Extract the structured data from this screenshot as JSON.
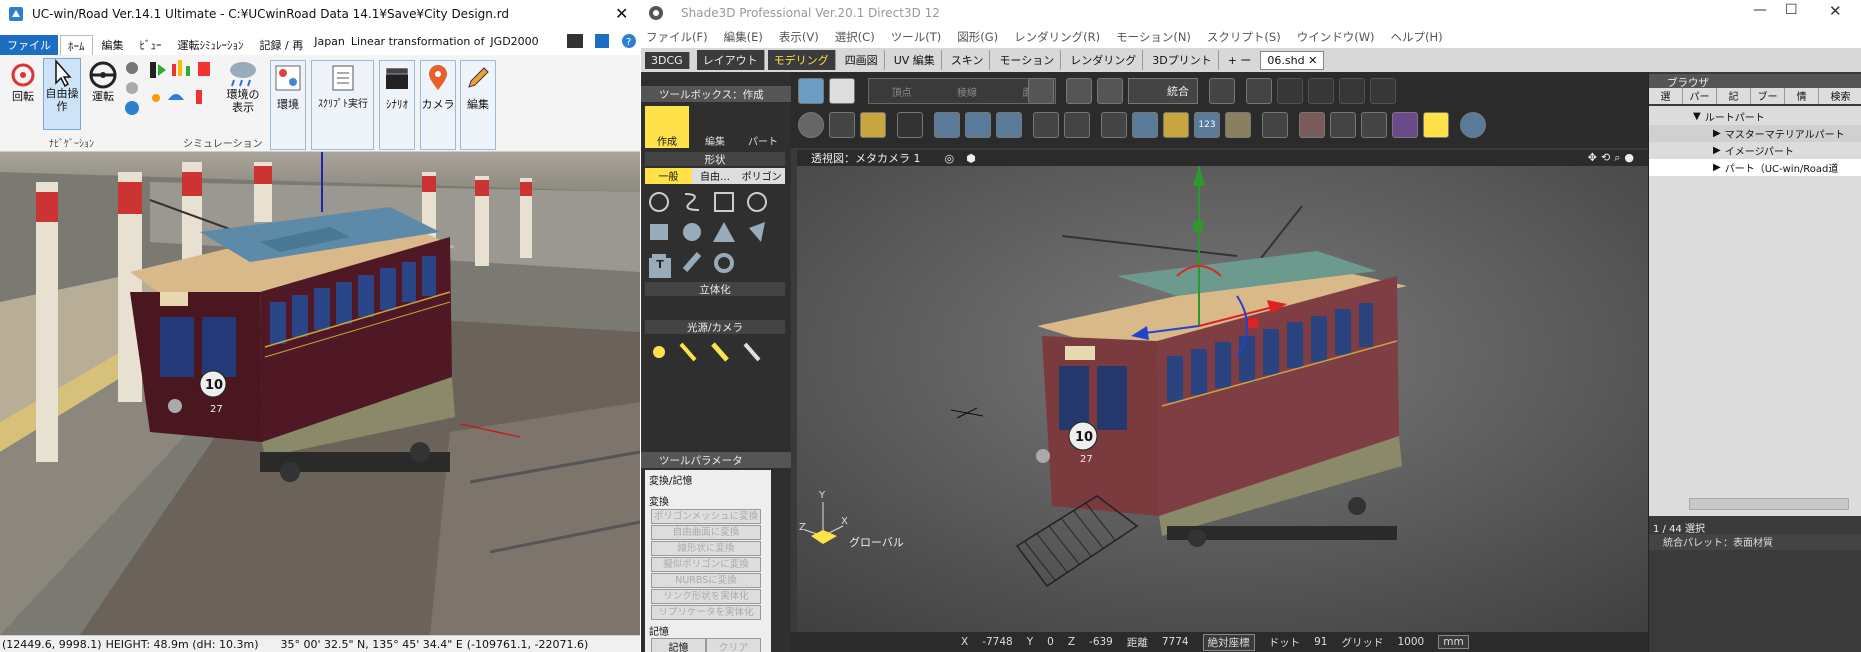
{
  "left": {
    "title": "UC-win/Road Ver.14.1 Ultimate - C:¥UCwinRoad Data 14.1¥Save¥City Design.rd",
    "tabs": [
      "ファイル",
      "ﾎｰﾑ",
      "編集",
      "ﾋﾞｭｰ",
      "運転ｼﾐｭﾚｰｼｮﾝ",
      "記録 / 再",
      "Japan",
      "Linear transformation of",
      "JGD2000"
    ],
    "ribbon": {
      "rotate": "回転",
      "free_nav": "自由操\n作",
      "drive": "運転",
      "nav_group": "ﾅﾋﾞｹﾞｰｼｮﾝ",
      "sim_group": "シミュレーション",
      "env_display": "環境の\n表示",
      "environment": "環境",
      "script_run": "ｽｸﾘﾌﾟﾄ実行",
      "scenario": "ｼﾅﾘｵ",
      "camera": "カメラ",
      "edit": "編集"
    },
    "tram_number": "10",
    "tram_id": "27",
    "status": {
      "coords": "(12449.6, 9998.1)",
      "height": "HEIGHT: 48.9m (dH: 10.3m)",
      "latlon": "35° 00' 32.5\" N, 135° 45' 34.4\" E",
      "proj": "(-109761.1, -22071.6)"
    }
  },
  "right": {
    "title": "Shade3D Professional Ver.20.1 Direct3D 12",
    "menu": [
      "ファイル(F)",
      "編集(E)",
      "表示(V)",
      "選択(C)",
      "ツール(T)",
      "図形(G)",
      "レンダリング(R)",
      "モーション(N)",
      "スクリプト(S)",
      "ウインドウ(W)",
      "ヘルプ(H)"
    ],
    "tabs": [
      "3DCG",
      "レイアウト",
      "モデリング",
      "四画図",
      "UV 編集",
      "スキン",
      "モーション",
      "レンダリング",
      "3Dプリント",
      "+ ー",
      "06.shd ✕"
    ],
    "toolbox": {
      "title": "ツールボックス：作成",
      "modes": [
        "作成",
        "編集",
        "パート"
      ],
      "shape_section": "形状",
      "shape_tabs": [
        "一般",
        "自由…",
        "ポリゴン"
      ],
      "solid_section": "立体化",
      "light_section": "光源/カメラ"
    },
    "toolbar_labels": {
      "vertex": "頂点",
      "edge": "稜線",
      "face": "面",
      "merge": "統合"
    },
    "params": {
      "title": "ツールパラメータ",
      "group": "変換/記憶",
      "convert_label": "変換",
      "convert_buttons": [
        "ポリゴンメッシュに変換",
        "自由曲面に変換",
        "線形状に変換",
        "擬似ポリゴンに変換",
        "NURBSに変換",
        "リンク形状を実体化",
        "リプリケータを実体化"
      ],
      "memory_label": "記憶",
      "memory_buttons": [
        "記憶",
        "クリア"
      ]
    },
    "viewport": {
      "label": "透視図：メタカメラ 1",
      "axis_label": "グローバル",
      "axes": [
        "Y",
        "X",
        "Z"
      ]
    },
    "status": {
      "x_label": "X",
      "x": "-7748",
      "y_label": "Y",
      "y": "0",
      "z_label": "Z",
      "z": "-639",
      "dist_label": "距離",
      "dist": "7774",
      "abs": "絶対座標",
      "dot_label": "ドット",
      "dot": "91",
      "grid_label": "グリッド",
      "grid": "1000",
      "unit": "mm"
    },
    "browser": {
      "title": "ブラウザ",
      "cols": [
        "選",
        "パー",
        "記",
        "ブー",
        "情",
        "検索"
      ],
      "tree": [
        "ルートパート",
        "マスターマテリアルパート",
        "イメージパート",
        "パート（UC-win/Road道"
      ],
      "count": "1 / 44 選択",
      "palette": "統合パレット：表面材質"
    }
  },
  "colors": {
    "accent": "#1b6ec2",
    "highlight": "#ffe24a",
    "tram_body": "#4a1620",
    "roof": "#d9b98a"
  }
}
